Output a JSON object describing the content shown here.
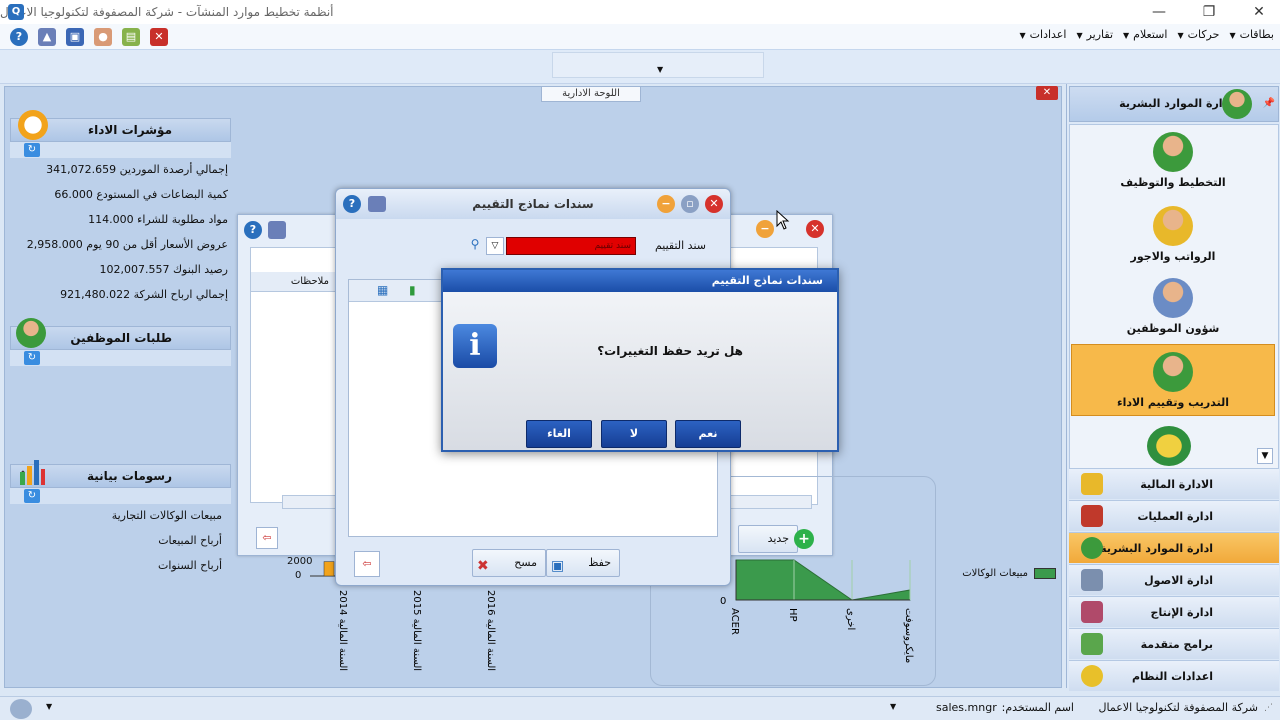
{
  "window": {
    "title": "أنظمة تخطيط موارد المنشآت - شركة المصفوفة لتكنولوجيا الاعمال"
  },
  "menu": [
    "بطاقات",
    "حركات",
    "استعلام",
    "تقارير",
    "اعدادات"
  ],
  "dashboard": {
    "tab_label": "اللوحة الادارية"
  },
  "kpi_panel": {
    "title": "مؤشرات الاداء",
    "rows": [
      {
        "label": "إجمالي أرصدة الموردين",
        "value": "341,072.659"
      },
      {
        "label": "كمية البضاعات في المستودع",
        "value": "66.000"
      },
      {
        "label": "مواد مطلوبة للشراء",
        "value": "114.000"
      },
      {
        "label": "عروض الأسعار أقل من 90 يوم",
        "value": "2,958.000"
      },
      {
        "label": "رصيد البنوك",
        "value": "102,007.557"
      },
      {
        "label": "إجمالي ارباح الشركة",
        "value": "921,480.022"
      }
    ]
  },
  "employees_panel": {
    "title": "طلبات الموظفين"
  },
  "charts_panel": {
    "title": "رسومات بيانية",
    "links": [
      "مبيعات الوكالات التجارية",
      "أرباح المبيعات",
      "أرباح السنوات"
    ]
  },
  "back_window": {
    "col_notes": "ملاحظات",
    "new_label": "جديد"
  },
  "chart_data": [
    {
      "type": "bar",
      "categories": [
        "السنة المالية 2014",
        "السنة المالية 2015",
        "السنة المالية 2016"
      ],
      "y_ticks": [
        "2000",
        "0"
      ],
      "values": [
        400,
        0,
        0
      ]
    },
    {
      "type": "area",
      "categories": [
        "ACER",
        "HP",
        "اخرى",
        "مايكروسوفت"
      ],
      "values": [
        1200,
        1200,
        0,
        300
      ],
      "y_ticks": [
        "0"
      ],
      "legend": [
        "مبيعات الوكالات"
      ]
    }
  ],
  "sanad_dialog": {
    "title": "سندات نماذج التقييم",
    "field_label": "سند التقييم",
    "field_value": "سند تقييم",
    "save_label": "حفظ",
    "clear_label": "مسح"
  },
  "message_box": {
    "title": "سندات نماذج التقييم",
    "text": "هل تريد حفظ التغييرات؟",
    "yes": "نعم",
    "no": "لا",
    "cancel": "الغاء"
  },
  "nav": {
    "title": "ادارة الموارد البشرية",
    "big_items": [
      "التخطيط والتوظيف",
      "الرواتب والاجور",
      "شؤون الموظفين",
      "التدريب وتقييم الاداء"
    ],
    "modules": [
      "الادارة المالية",
      "ادارة العمليات",
      "ادارة الموارد البشرية",
      "ادارة الاصول",
      "ادارة الإنتاج",
      "برامج متقدمة",
      "اعدادات النظام"
    ]
  },
  "statusbar": {
    "company": "شركة المصفوفة لتكنولوجيا الاعمال",
    "user_label": "اسم المستخدم:",
    "user_value": "sales.mngr"
  },
  "colors": {
    "accent_orange": "#f7b94a",
    "chart_green": "#3b9a4c",
    "dialog_blue": "#1b4ea8",
    "alert_red": "#e00000"
  }
}
